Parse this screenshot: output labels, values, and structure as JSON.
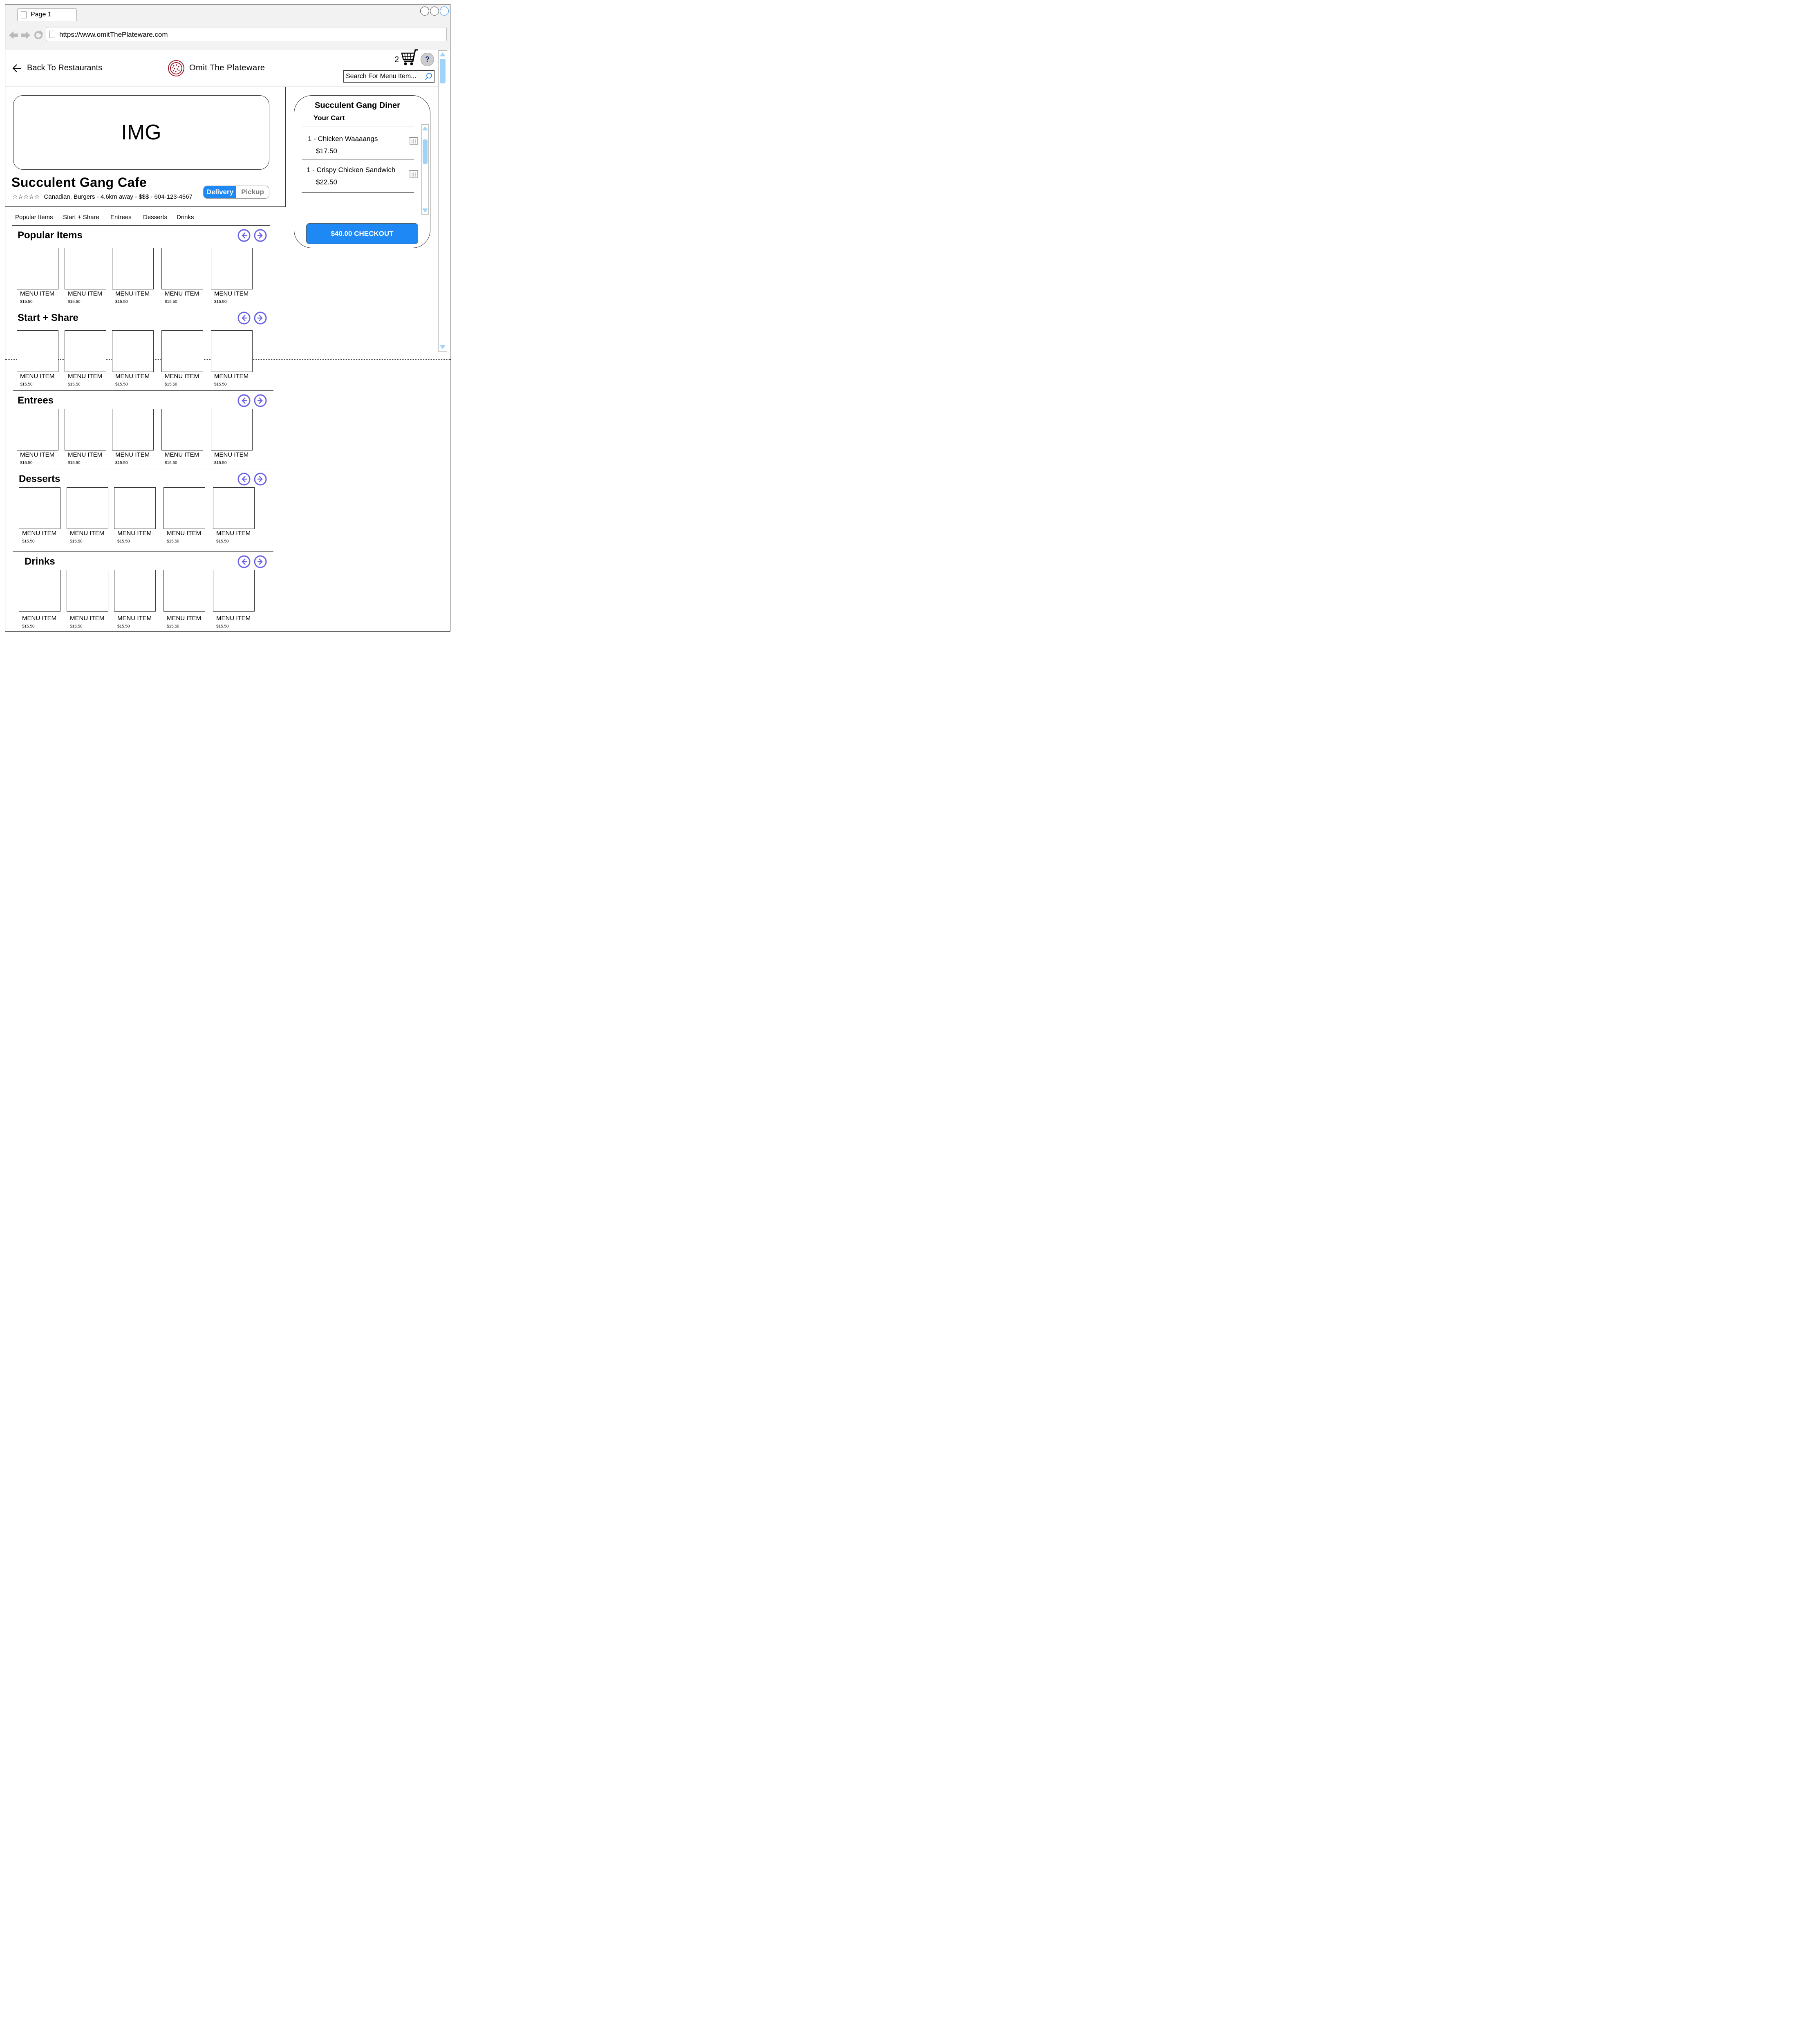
{
  "browser": {
    "tab_title": "Page 1",
    "url": "https://www.omitThePlateware.com"
  },
  "header": {
    "back_label": "Back To Restaurants",
    "brand_name": "Omit The Plateware",
    "cart_count": "2",
    "help_label": "?",
    "search_placeholder": "Search For Menu Item..."
  },
  "restaurant": {
    "image_placeholder": "IMG",
    "name": "Succulent Gang Cafe",
    "rating_stars": "☆☆☆☆☆",
    "meta": "Canadian, Burgers - 4.6km away - $$$ - 604-123-4567",
    "mode_options": [
      "Delivery",
      "Pickup"
    ],
    "selected_mode": "Delivery"
  },
  "category_nav": [
    "Popular Items",
    "Start + Share",
    "Entrees",
    "Desserts",
    "Drinks"
  ],
  "cart": {
    "restaurant": "Succulent Gang Diner",
    "subtitle": "Your Cart",
    "items": [
      {
        "line": "1 - Chicken Waaaangs",
        "price": "$17.50"
      },
      {
        "line": "1 - Crispy Chicken Sandwich",
        "price": "$22.50"
      }
    ],
    "checkout_label": "$40.00 CHECKOUT"
  },
  "sections": [
    {
      "title": "Popular Items",
      "items": [
        {
          "name": "MENU ITEM",
          "price": "$15.50"
        },
        {
          "name": "MENU ITEM",
          "price": "$15.50"
        },
        {
          "name": "MENU ITEM",
          "price": "$15.50"
        },
        {
          "name": "MENU ITEM",
          "price": "$15.50"
        },
        {
          "name": "MENU ITEM",
          "price": "$15.50"
        }
      ]
    },
    {
      "title": "Start + Share",
      "items": [
        {
          "name": "MENU ITEM",
          "price": "$15.50"
        },
        {
          "name": "MENU ITEM",
          "price": "$15.50"
        },
        {
          "name": "MENU ITEM",
          "price": "$15.50"
        },
        {
          "name": "MENU ITEM",
          "price": "$15.50"
        },
        {
          "name": "MENU ITEM",
          "price": "$15.50"
        }
      ]
    },
    {
      "title": "Entrees",
      "items": [
        {
          "name": "MENU ITEM",
          "price": "$15.50"
        },
        {
          "name": "MENU ITEM",
          "price": "$15.50"
        },
        {
          "name": "MENU ITEM",
          "price": "$15.50"
        },
        {
          "name": "MENU ITEM",
          "price": "$15.50"
        },
        {
          "name": "MENU ITEM",
          "price": "$15.50"
        }
      ]
    },
    {
      "title": "Desserts",
      "items": [
        {
          "name": "MENU ITEM",
          "price": "$15.50"
        },
        {
          "name": "MENU ITEM",
          "price": "$15.50"
        },
        {
          "name": "MENU ITEM",
          "price": "$15.50"
        },
        {
          "name": "MENU ITEM",
          "price": "$15.50"
        },
        {
          "name": "MENU ITEM",
          "price": "$15.50"
        }
      ]
    },
    {
      "title": "Drinks",
      "items": [
        {
          "name": "MENU ITEM",
          "price": "$15.50"
        },
        {
          "name": "MENU ITEM",
          "price": "$15.50"
        },
        {
          "name": "MENU ITEM",
          "price": "$15.50"
        },
        {
          "name": "MENU ITEM",
          "price": "$15.50"
        },
        {
          "name": "MENU ITEM",
          "price": "$15.50"
        }
      ]
    }
  ],
  "colors": {
    "accent_blue": "#1e88f5",
    "arrow_purple": "#6b63e6",
    "scrollbar_blue": "#9fd3f7",
    "logo_red": "#9b1b30"
  },
  "icons": [
    "back-arrow-icon",
    "plate-logo-icon",
    "cart-icon",
    "help-icon",
    "search-icon",
    "trash-icon",
    "left-arrow-icon",
    "right-arrow-icon"
  ]
}
